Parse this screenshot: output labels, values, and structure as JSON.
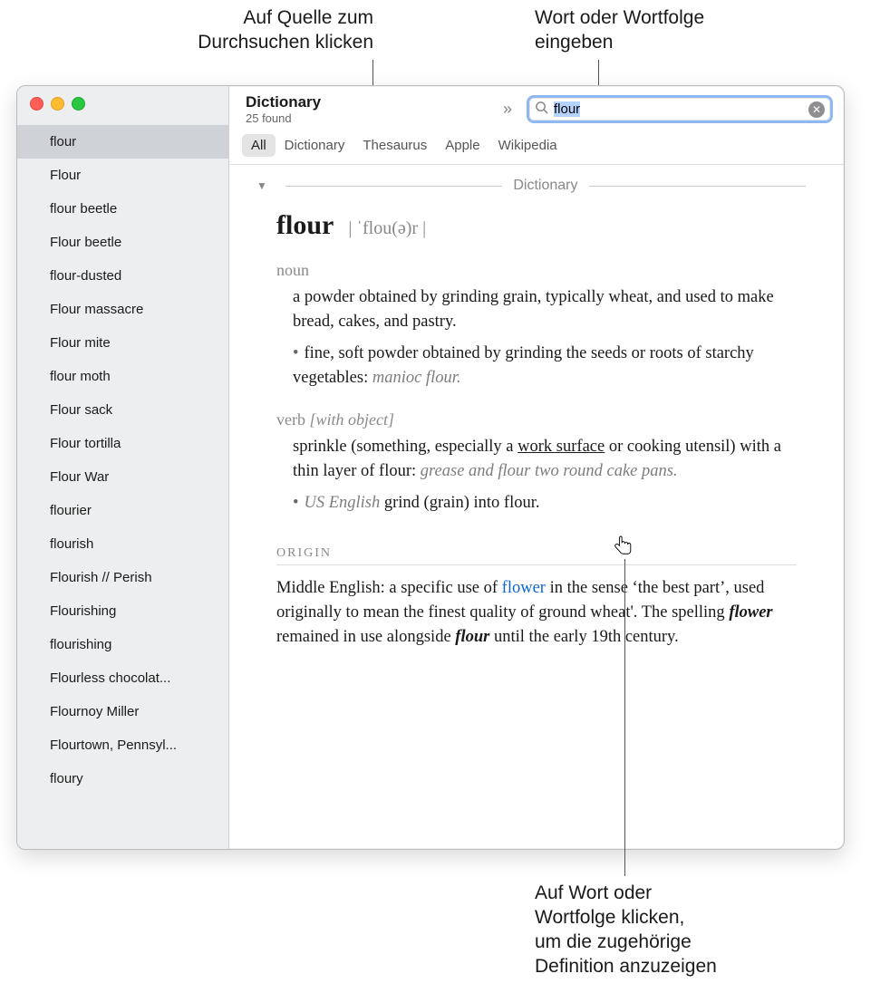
{
  "callouts": {
    "top_left": "Auf Quelle zum\nDurchsuchen klicken",
    "top_right": "Wort oder Wortfolge\neingeben",
    "bottom": "Auf Wort oder\nWortfolge klicken,\num die zugehörige\nDefinition anzuzeigen"
  },
  "window": {
    "title": "Dictionary",
    "subtitle": "25 found",
    "search_value": "flour",
    "tabs": [
      "All",
      "Dictionary",
      "Thesaurus",
      "Apple",
      "Wikipedia"
    ],
    "active_tab": 0,
    "section_title": "Dictionary"
  },
  "sidebar": {
    "selected_index": 0,
    "items": [
      "flour",
      "Flour",
      "flour beetle",
      "Flour beetle",
      "flour-dusted",
      "Flour massacre",
      "Flour mite",
      "flour moth",
      "Flour sack",
      "Flour tortilla",
      "Flour War",
      "flourier",
      "flourish",
      "Flourish // Perish",
      "Flourishing",
      "flourishing",
      "Flourless chocolat...",
      "Flournoy Miller",
      "Flourtown, Pennsyl...",
      "floury"
    ]
  },
  "entry": {
    "headword": "flour",
    "pronunciation": "| ˈflou(ə)r |",
    "noun_label": "noun",
    "noun_def": "a powder obtained by grinding grain, typically wheat, and used to make bread, cakes, and pastry",
    "noun_sub": "fine, soft powder obtained by grinding the seeds or roots of starchy vegetables: ",
    "noun_sub_example": "manioc flour.",
    "verb_label": "verb",
    "verb_qual": "[with object]",
    "verb_def_pre": "sprinkle (something, especially a ",
    "verb_def_underlined": "work surface",
    "verb_def_post": " or cooking utensil) with a thin layer of flour: ",
    "verb_example": "grease and flour two round cake pans.",
    "verb_sub_label": "US English",
    "verb_sub_text": " grind (grain) into flour",
    "origin_label": "ORIGIN",
    "origin_pre": "Middle English: a specific use of ",
    "origin_link": "flower",
    "origin_mid1": " in the sense ‘the best part’, used originally to mean the finest quality of ground wheat'. The spelling ",
    "origin_bi1": "flower",
    "origin_mid2": " remained in use alongside ",
    "origin_bi2": "flour",
    "origin_end": " until the early 19th century."
  }
}
